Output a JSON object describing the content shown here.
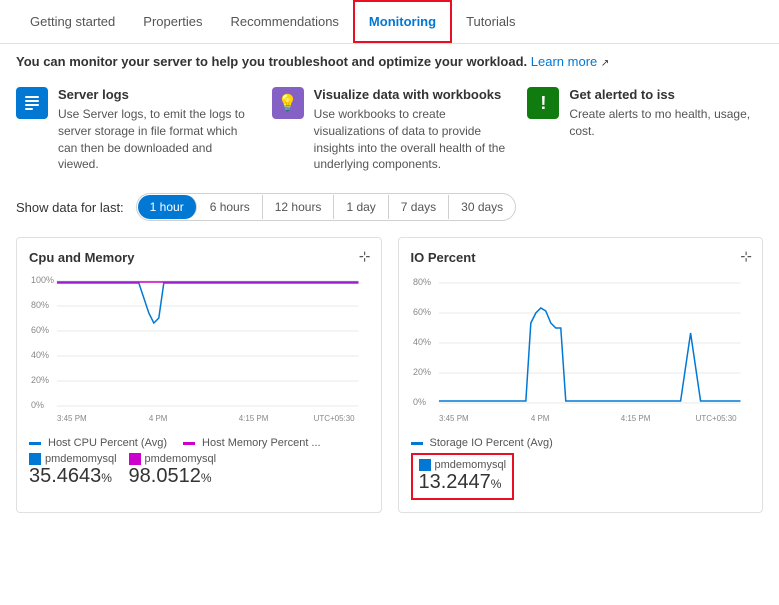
{
  "nav": {
    "items": [
      {
        "label": "Getting started",
        "active": false
      },
      {
        "label": "Properties",
        "active": false
      },
      {
        "label": "Recommendations",
        "active": false
      },
      {
        "label": "Monitoring",
        "active": true
      },
      {
        "label": "Tutorials",
        "active": false
      }
    ]
  },
  "infoBar": {
    "text": "You can monitor your server to help you troubleshoot and optimize your workload.",
    "link": "Learn more"
  },
  "featureCards": [
    {
      "iconChar": "☰",
      "iconStyle": "blue",
      "title": "Server logs",
      "description": "Use Server logs, to emit the logs to server storage in file format which can then be downloaded and viewed."
    },
    {
      "iconChar": "💡",
      "iconStyle": "purple",
      "title": "Visualize data with workbooks",
      "description": "Use workbooks to create visualizations of data to provide insights into the overall health of the underlying components."
    },
    {
      "iconChar": "!",
      "iconStyle": "green",
      "title": "Get alerted to iss",
      "description": "Create alerts to mo health, usage, cost."
    }
  ],
  "timeFilter": {
    "label": "Show data for last:",
    "options": [
      {
        "label": "1 hour",
        "active": true
      },
      {
        "label": "6 hours",
        "active": false
      },
      {
        "label": "12 hours",
        "active": false
      },
      {
        "label": "1 day",
        "active": false
      },
      {
        "label": "7 days",
        "active": false
      },
      {
        "label": "30 days",
        "active": false
      }
    ]
  },
  "charts": [
    {
      "title": "Cpu and Memory",
      "timezone": "UTC+05:30",
      "times": [
        "3:45 PM",
        "4 PM",
        "4:15 PM"
      ],
      "yLabels": [
        "100%",
        "80%",
        "60%",
        "40%",
        "20%",
        "0%"
      ],
      "legends": [
        {
          "color": "#0078d4",
          "label": "Host CPU Percent (Avg)"
        },
        {
          "color": "#cc00cc",
          "label": "Host Memory Percent ..."
        }
      ],
      "metrics": [
        {
          "label": "pmdemomysql",
          "value": "35.4643",
          "unit": "%",
          "highlighted": false,
          "color": "#0078d4"
        },
        {
          "label": "pmdemomysql",
          "value": "98.0512",
          "unit": "%",
          "highlighted": false,
          "color": "#cc00cc"
        }
      ]
    },
    {
      "title": "IO Percent",
      "timezone": "UTC+05:30",
      "times": [
        "3:45 PM",
        "4 PM",
        "4:15 PM"
      ],
      "yLabels": [
        "80%",
        "60%",
        "40%",
        "20%",
        "0%"
      ],
      "legends": [
        {
          "color": "#0078d4",
          "label": "Storage IO Percent (Avg)"
        }
      ],
      "metrics": [
        {
          "label": "pmdemomysql",
          "value": "13.2447",
          "unit": "%",
          "highlighted": true,
          "color": "#0078d4"
        }
      ]
    }
  ]
}
